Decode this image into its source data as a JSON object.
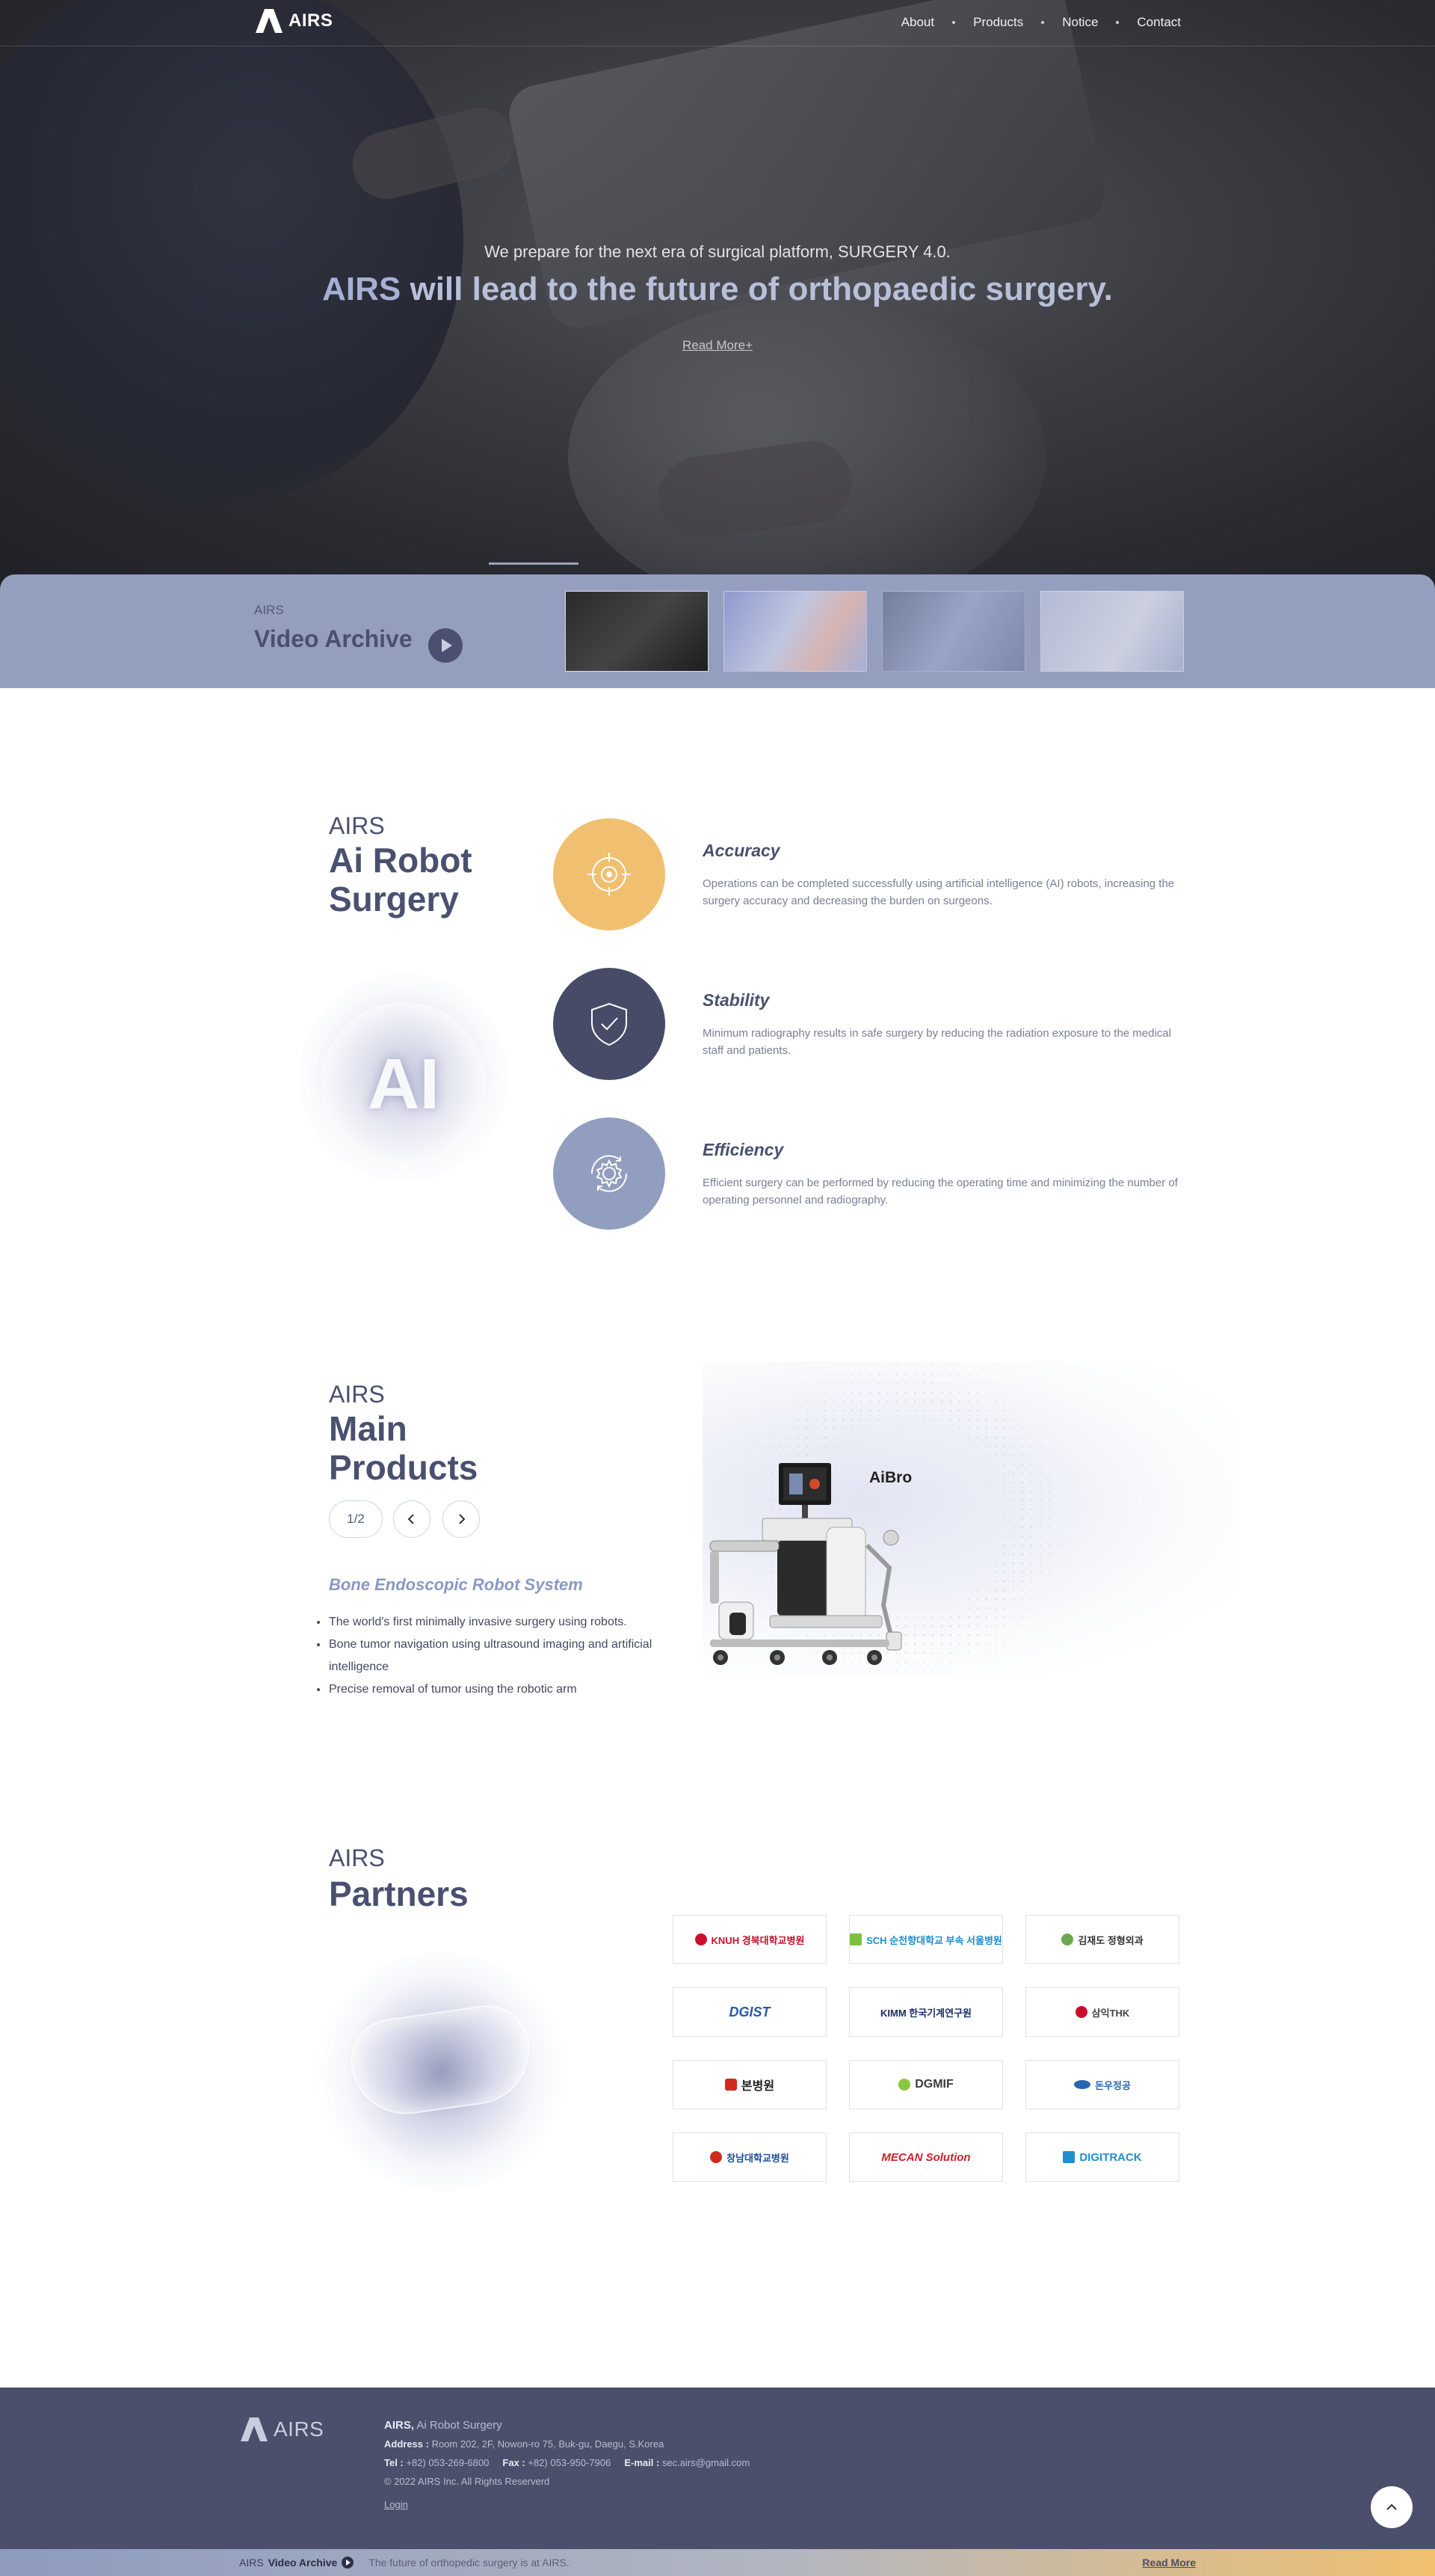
{
  "brand": "AIRS",
  "nav": {
    "items": [
      "About",
      "Products",
      "Notice",
      "Contact"
    ]
  },
  "hero": {
    "subtitle": "We prepare for the next era of surgical platform, SURGERY 4.0.",
    "title_brand": "AIRS",
    "title_rest": " will lead to the future of orthopaedic surgery.",
    "read_more": "Read More+"
  },
  "video_archive": {
    "brand": "AIRS",
    "title": "Video Archive",
    "thumbnails": 4
  },
  "surgery": {
    "brand": "AIRS",
    "title_line1": "Ai Robot",
    "title_line2": "Surgery",
    "orb_text": "AI",
    "features": [
      {
        "title": "Accuracy",
        "desc": "Operations can be completed successfully using artificial intelligence (AI) robots, increasing the surgery accuracy and decreasing the burden on surgeons.",
        "icon": "target-icon",
        "color": "#f0c070"
      },
      {
        "title": "Stability",
        "desc": "Minimum radiography results in safe surgery by reducing the radiation exposure to the medical staff and patients.",
        "icon": "shield-check-icon",
        "color": "#474b68"
      },
      {
        "title": "Efficiency",
        "desc": "Efficient surgery can be performed by reducing the operating time and minimizing the number of operating personnel and radiography.",
        "icon": "gear-cycle-icon",
        "color": "#929ebf"
      }
    ]
  },
  "products": {
    "brand": "AIRS",
    "title_line1": "Main",
    "title_line2": "Products",
    "pager": "1/2",
    "name": "Bone Endoscopic Robot System",
    "bullets": [
      "The world's first minimally invasive surgery using robots.",
      "Bone tumor navigation using ultrasound imaging and artificial intelligence",
      "Precise removal of tumor using the robotic arm"
    ],
    "robot_label": "AiBro"
  },
  "partners": {
    "brand": "AIRS",
    "title": "Partners",
    "logos": [
      {
        "name": "KNUH 경북대학교병원",
        "color": "#c8102e"
      },
      {
        "name": "SCH 순천향대학교 부속 서울병원",
        "color": "#1b8fd2"
      },
      {
        "name": "김재도 정형외과",
        "color": "#333333"
      },
      {
        "name": "DGIST",
        "color": "#2a5aa8"
      },
      {
        "name": "KIMM 한국기계연구원",
        "color": "#1c2a6b"
      },
      {
        "name": "삼익THK",
        "color": "#c8102e"
      },
      {
        "name": "본병원",
        "color": "#d02a1f"
      },
      {
        "name": "DGMIF",
        "color": "#3b8a2a"
      },
      {
        "name": "돈우정공",
        "color": "#2a66b0"
      },
      {
        "name": "창남대학교병원",
        "color": "#1f4ea0"
      },
      {
        "name": "MECAN Solution",
        "color": "#d01f2a"
      },
      {
        "name": "DIGITRACK",
        "color": "#1f8fd0"
      }
    ]
  },
  "footer": {
    "company": "AIRS,",
    "company_desc": " Ai Robot Surgery",
    "address_label": "Address :",
    "address": " Room 202, 2F, Nowon-ro 75, Buk-gu, Daegu, S.Korea",
    "tel_label": "Tel :",
    "tel": " +82) 053-269-6800",
    "fax_label": "Fax :",
    "fax": " +82) 053-950-7906",
    "email_label": "E-mail :",
    "email": " sec.airs@gmail.com",
    "copyright": "© 2022 AIRS Inc. All Rights Reserverd",
    "login": "Login"
  },
  "bottom_bar": {
    "brand": "AIRS",
    "title": "Video Archive",
    "message": "The future of orthopedic surgery is at AIRS.",
    "read_more": "Read More"
  }
}
